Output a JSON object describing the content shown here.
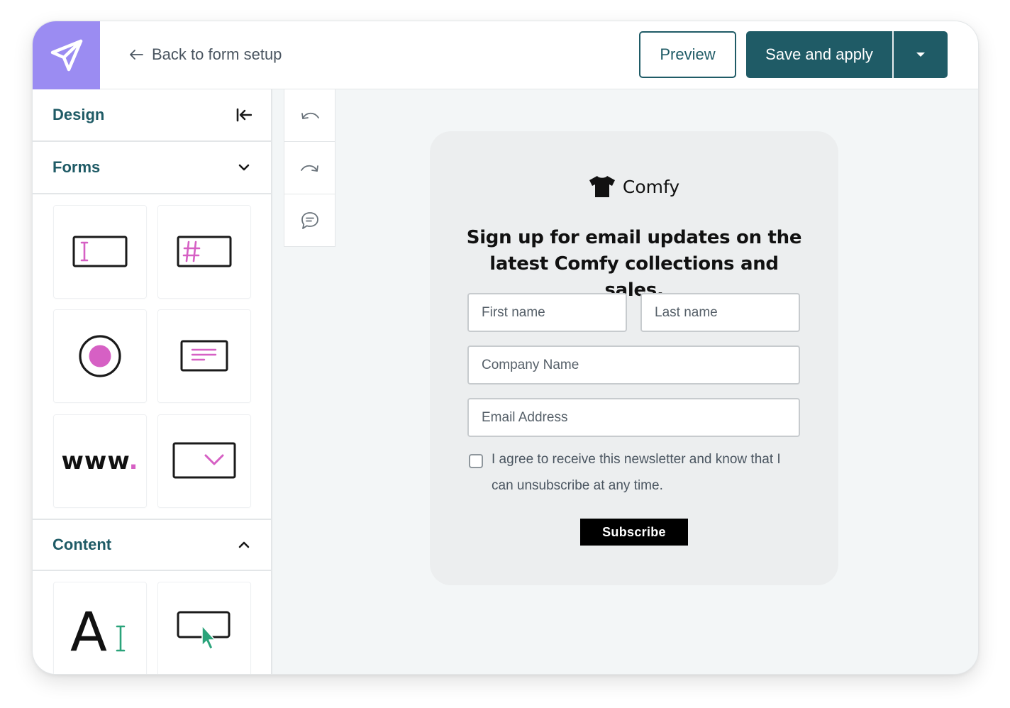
{
  "topbar": {
    "logo_icon": "paper-plane-icon",
    "back_label": "Back to form setup",
    "preview_label": "Preview",
    "save_label": "Save and apply"
  },
  "sidebar": {
    "design_title": "Design",
    "forms_title": "Forms",
    "content_title": "Content",
    "form_tiles": [
      "text-field-icon",
      "number-field-icon",
      "radio-icon",
      "paragraph-field-icon",
      "url-field-icon",
      "dropdown-field-icon"
    ],
    "www_label": "www",
    "www_dot": ".",
    "content_tiles": [
      "text-block-icon",
      "button-block-icon"
    ],
    "text_tile_letter": "A"
  },
  "tools": [
    "undo-icon",
    "redo-icon",
    "comment-icon"
  ],
  "form": {
    "brand_name": "Comfy",
    "headline_line1": "Sign up for email updates on the",
    "headline_line2": "latest Comfy collections and sales.",
    "first_name_placeholder": "First name",
    "last_name_placeholder": "Last name",
    "company_placeholder": "Company Name",
    "email_placeholder": "Email Address",
    "consent_line1": "I agree to receive this newsletter and know that I",
    "consent_line2": "can unsubscribe at any time.",
    "subscribe_label": "Subscribe"
  },
  "colors": {
    "brand_teal": "#1f5b66",
    "logo_purple": "#9b8cf2",
    "accent_pink": "#d660c4",
    "accent_green": "#2aa37a"
  }
}
